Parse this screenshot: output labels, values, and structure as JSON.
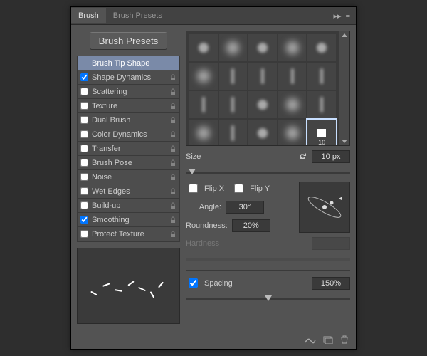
{
  "tabs": {
    "brush": "Brush",
    "presets": "Brush Presets"
  },
  "presetBtn": "Brush Presets",
  "opts": [
    {
      "label": "Brush Tip Shape",
      "checkbox": false,
      "lock": false,
      "sel": true
    },
    {
      "label": "Shape Dynamics",
      "checkbox": true,
      "checked": true,
      "lock": true
    },
    {
      "label": "Scattering",
      "checkbox": true,
      "checked": false,
      "lock": true
    },
    {
      "label": "Texture",
      "checkbox": true,
      "checked": false,
      "lock": true
    },
    {
      "label": "Dual Brush",
      "checkbox": true,
      "checked": false,
      "lock": true
    },
    {
      "label": "Color Dynamics",
      "checkbox": true,
      "checked": false,
      "lock": true
    },
    {
      "label": "Transfer",
      "checkbox": true,
      "checked": false,
      "lock": true
    },
    {
      "label": "Brush Pose",
      "checkbox": true,
      "checked": false,
      "lock": true
    },
    {
      "label": "Noise",
      "checkbox": true,
      "checked": false,
      "lock": true
    },
    {
      "label": "Wet Edges",
      "checkbox": true,
      "checked": false,
      "lock": true
    },
    {
      "label": "Build-up",
      "checkbox": true,
      "checked": false,
      "lock": true
    },
    {
      "label": "Smoothing",
      "checkbox": true,
      "checked": true,
      "lock": true
    },
    {
      "label": "Protect Texture",
      "checkbox": true,
      "checked": false,
      "lock": true
    }
  ],
  "selectedThumb": "10",
  "size": {
    "label": "Size",
    "value": "10 px"
  },
  "flip": {
    "x": "Flip X",
    "y": "Flip Y"
  },
  "angle": {
    "label": "Angle:",
    "value": "30°"
  },
  "roundness": {
    "label": "Roundness:",
    "value": "20%"
  },
  "hardness": {
    "label": "Hardness"
  },
  "spacing": {
    "label": "Spacing",
    "value": "150%"
  }
}
